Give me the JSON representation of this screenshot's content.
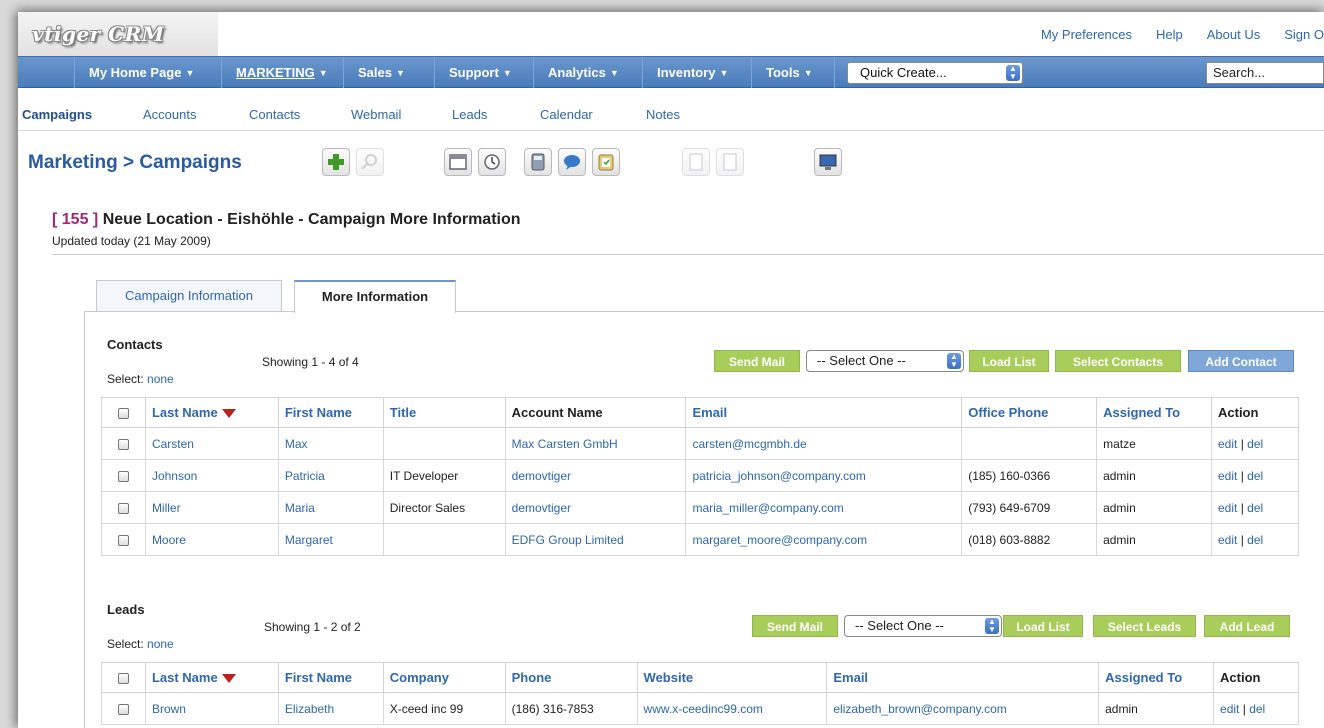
{
  "app": {
    "logo": "vtiger CRM"
  },
  "top_links": [
    "My Preferences",
    "Help",
    "About Us",
    "Sign O"
  ],
  "main_nav": [
    {
      "label": "My Home Page",
      "active": false
    },
    {
      "label": "MARKETING",
      "active": true
    },
    {
      "label": "Sales",
      "active": false
    },
    {
      "label": "Support",
      "active": false
    },
    {
      "label": "Analytics",
      "active": false
    },
    {
      "label": "Inventory",
      "active": false
    },
    {
      "label": "Tools",
      "active": false
    }
  ],
  "quick_create": {
    "value": "Quick Create..."
  },
  "search": {
    "placeholder": "Search..."
  },
  "sub_nav": [
    "Campaigns",
    "Accounts",
    "Contacts",
    "Webmail",
    "Leads",
    "Calendar",
    "Notes"
  ],
  "page": {
    "breadcrumb": "Marketing > Campaigns"
  },
  "toolbar_icons": [
    "add-icon",
    "search-icon",
    "calendar-icon",
    "clock-icon",
    "calculator-icon",
    "chat-icon",
    "clipboard-icon",
    "import-icon",
    "export-icon",
    "monitor-icon"
  ],
  "record": {
    "id": "[ 155 ]",
    "title": "Neue Location - Eishöhle - Campaign More Information",
    "updated": "Updated today (21 May 2009)"
  },
  "tabs": [
    "Campaign Information",
    "More Information"
  ],
  "contacts": {
    "title": "Contacts",
    "select_label": "Select:",
    "select_link": "none",
    "showing": "Showing 1 - 4 of 4",
    "buttons": {
      "send_mail": "Send Mail",
      "select_one": "-- Select One --",
      "load_list": "Load List",
      "select": "Select Contacts",
      "add": "Add Contact"
    },
    "columns": [
      "Last Name",
      "First Name",
      "Title",
      "Account Name",
      "Email",
      "Office Phone",
      "Assigned To",
      "Action"
    ],
    "rows": [
      [
        "Carsten",
        "Max",
        "",
        "Max Carsten GmbH",
        "carsten@mcgmbh.de",
        "",
        "matze"
      ],
      [
        "Johnson",
        "Patricia",
        "IT Developer",
        "demovtiger",
        "patricia_johnson@company.com",
        "(185) 160-0366",
        "admin"
      ],
      [
        "Miller",
        "Maria",
        "Director Sales",
        "demovtiger",
        "maria_miller@company.com",
        "(793) 649-6709",
        "admin"
      ],
      [
        "Moore",
        "Margaret",
        "",
        "EDFG Group Limited",
        "margaret_moore@company.com",
        "(018) 603-8882",
        "admin"
      ]
    ],
    "action_edit": "edit",
    "action_sep": "|",
    "action_del": "del"
  },
  "leads": {
    "title": "Leads",
    "select_label": "Select:",
    "select_link": "none",
    "showing": "Showing 1 - 2 of 2",
    "buttons": {
      "send_mail": "Send Mail",
      "select_one": "-- Select One --",
      "load_list": "Load List",
      "select": "Select Leads",
      "add": "Add Lead"
    },
    "columns": [
      "Last Name",
      "First Name",
      "Company",
      "Phone",
      "Website",
      "Email",
      "Assigned To",
      "Action"
    ],
    "rows": [
      [
        "Brown",
        "Elizabeth",
        "X-ceed inc 99",
        "(186) 316-7853",
        "www.x-ceedinc99.com",
        "elizabeth_brown@company.com",
        "admin"
      ]
    ],
    "action_edit": "edit",
    "action_sep": "|",
    "action_del": "del"
  }
}
